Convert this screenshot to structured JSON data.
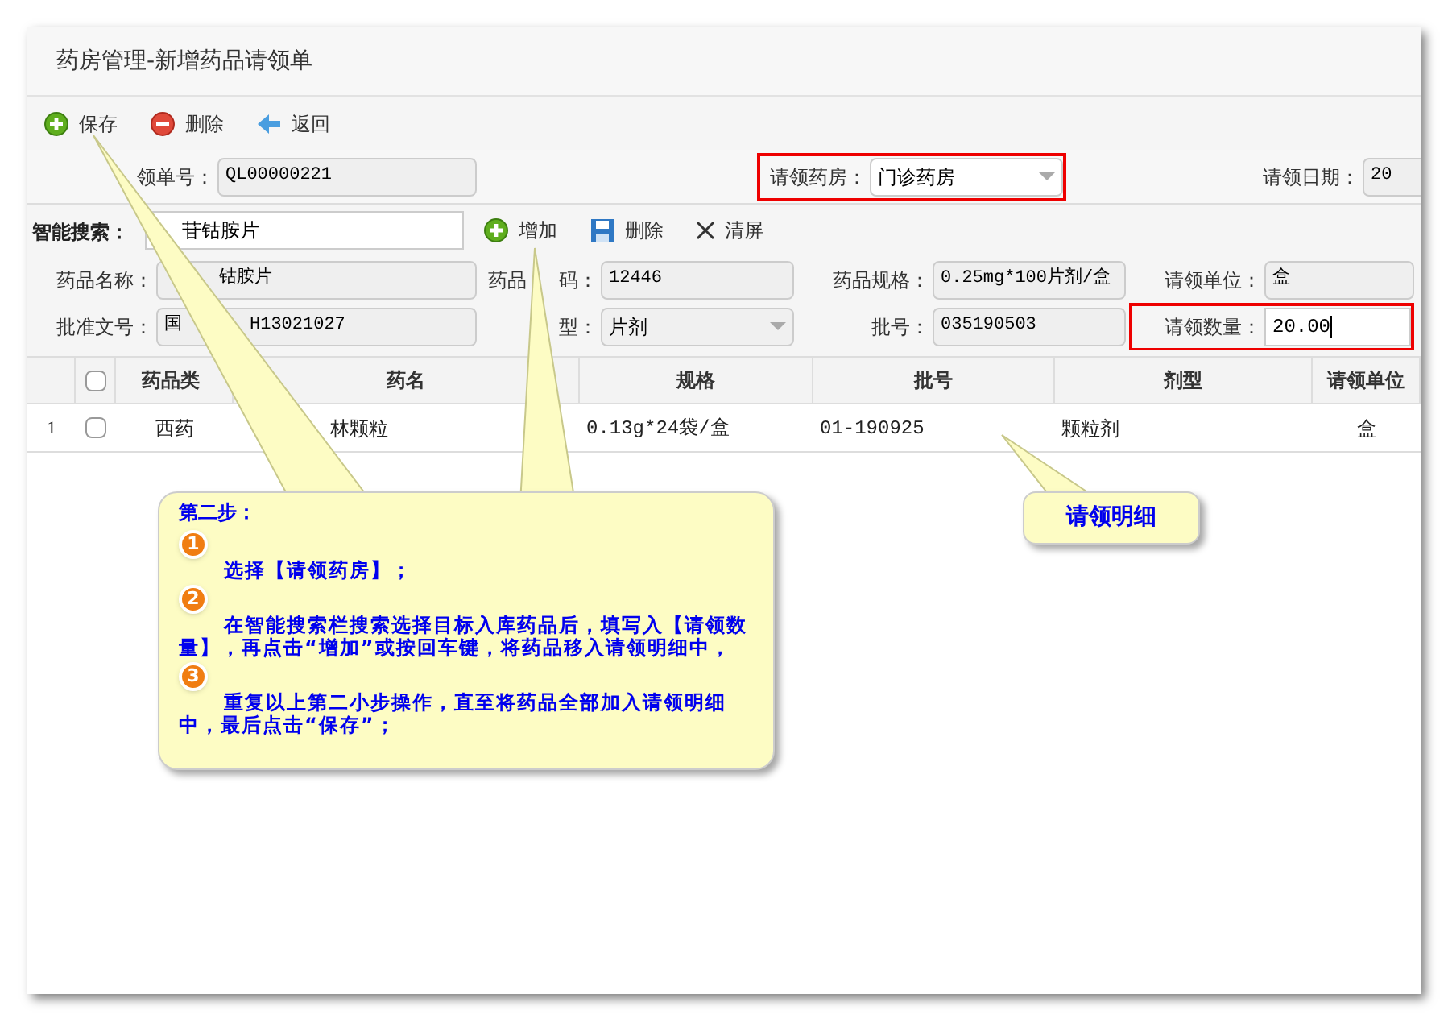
{
  "window": {
    "title": "药房管理-新增药品请领单"
  },
  "toolbar": [
    {
      "label": "保存",
      "kind": "add"
    },
    {
      "label": "删除",
      "kind": "remove"
    },
    {
      "label": "返回",
      "kind": "back"
    }
  ],
  "order_row": [
    {
      "label": "领单号：",
      "value": "QL00000221",
      "kind": "text",
      "highlighted": false
    },
    {
      "label": "请领药房：",
      "value": "门诊药房",
      "kind": "select",
      "highlighted": true
    },
    {
      "label": "请领日期：",
      "value": "20",
      "kind": "text",
      "highlighted": false
    }
  ],
  "search": {
    "label": "智能搜索：",
    "value": "苷钴胺片",
    "actions": [
      {
        "label": "增加",
        "kind": "add"
      },
      {
        "label": "删除",
        "kind": "save"
      },
      {
        "label": "清屏",
        "kind": "clear"
      }
    ]
  },
  "detail_rows": [
    [
      {
        "label": "药品名称：",
        "value": "钴胺片",
        "kind": "text",
        "highlighted": false
      },
      {
        "label_parts": [
          "药品",
          "码："
        ],
        "value": "12446",
        "kind": "text",
        "highlighted": false
      },
      {
        "label": "药品规格：",
        "value": "0.25mg*100片剂/盒",
        "kind": "text",
        "highlighted": false
      },
      {
        "label": "请领单位：",
        "value": "盒",
        "kind": "text",
        "highlighted": false
      }
    ],
    [
      {
        "label": "批准文号：",
        "value_parts": [
          "国",
          "H13021027"
        ],
        "kind": "text",
        "highlighted": false
      },
      {
        "label": "型：",
        "value": "片剂",
        "kind": "select",
        "highlighted": false
      },
      {
        "label": "批号：",
        "value": "035190503",
        "kind": "text",
        "highlighted": false
      },
      {
        "label": "请领数量：",
        "value": "20.00",
        "kind": "input",
        "highlighted": true
      }
    ]
  ],
  "table": {
    "columns": [
      "药品类",
      "药名",
      "规格",
      "批号",
      "剂型",
      "请领单位"
    ],
    "header_checked": false,
    "rows": [
      {
        "index": "1",
        "checked": false,
        "cells": [
          "西药",
          "林颗粒",
          "0.13g*24袋/盒",
          "01-190925",
          "颗粒剂",
          "盒"
        ]
      }
    ]
  },
  "callouts": [
    {
      "title": "第二步：",
      "steps": [
        {
          "number": "1",
          "text": "选择【请领药房】；"
        },
        {
          "number": "2",
          "text": "在智能搜索栏搜索选择目标入库药品后，填写入【请领数量】，再点击“增加”或按回车键，将药品移入请领明细中，"
        },
        {
          "number": "3",
          "text": "重复以上第二小步操作，直至将药品全部加入请领明细中，最后点击“保存”；"
        }
      ]
    },
    {
      "title": "请领明细"
    }
  ]
}
